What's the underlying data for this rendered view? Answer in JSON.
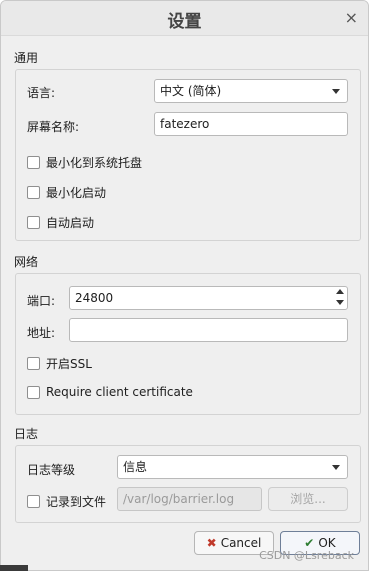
{
  "window": {
    "title": "设置",
    "close_glyph": "×"
  },
  "general": {
    "section_title": "通用",
    "language_label": "语言:",
    "language_value": "中文 (简体)",
    "screen_name_label": "屏幕名称:",
    "screen_name_value": "fatezero",
    "minimize_tray": "最小化到系统托盘",
    "start_minimized": "最小化启动",
    "autostart": "自动启动"
  },
  "network": {
    "section_title": "网络",
    "port_label": "端口:",
    "port_value": "24800",
    "address_label": "地址:",
    "address_value": "",
    "enable_ssl": "开启SSL",
    "require_cert": "Require client certificate"
  },
  "log": {
    "section_title": "日志",
    "level_label": "日志等级",
    "level_value": "信息",
    "log_to_file": "记录到文件",
    "log_path": "/var/log/barrier.log",
    "browse": "浏览..."
  },
  "buttons": {
    "cancel": "Cancel",
    "cancel_icon": "✖",
    "ok": "OK",
    "ok_icon": "✔"
  },
  "watermark": "CSDN @Lsreback",
  "colors": {
    "dialog_bg": "#efefef",
    "field_bg": "#ffffff",
    "border": "#b9b9b9"
  }
}
